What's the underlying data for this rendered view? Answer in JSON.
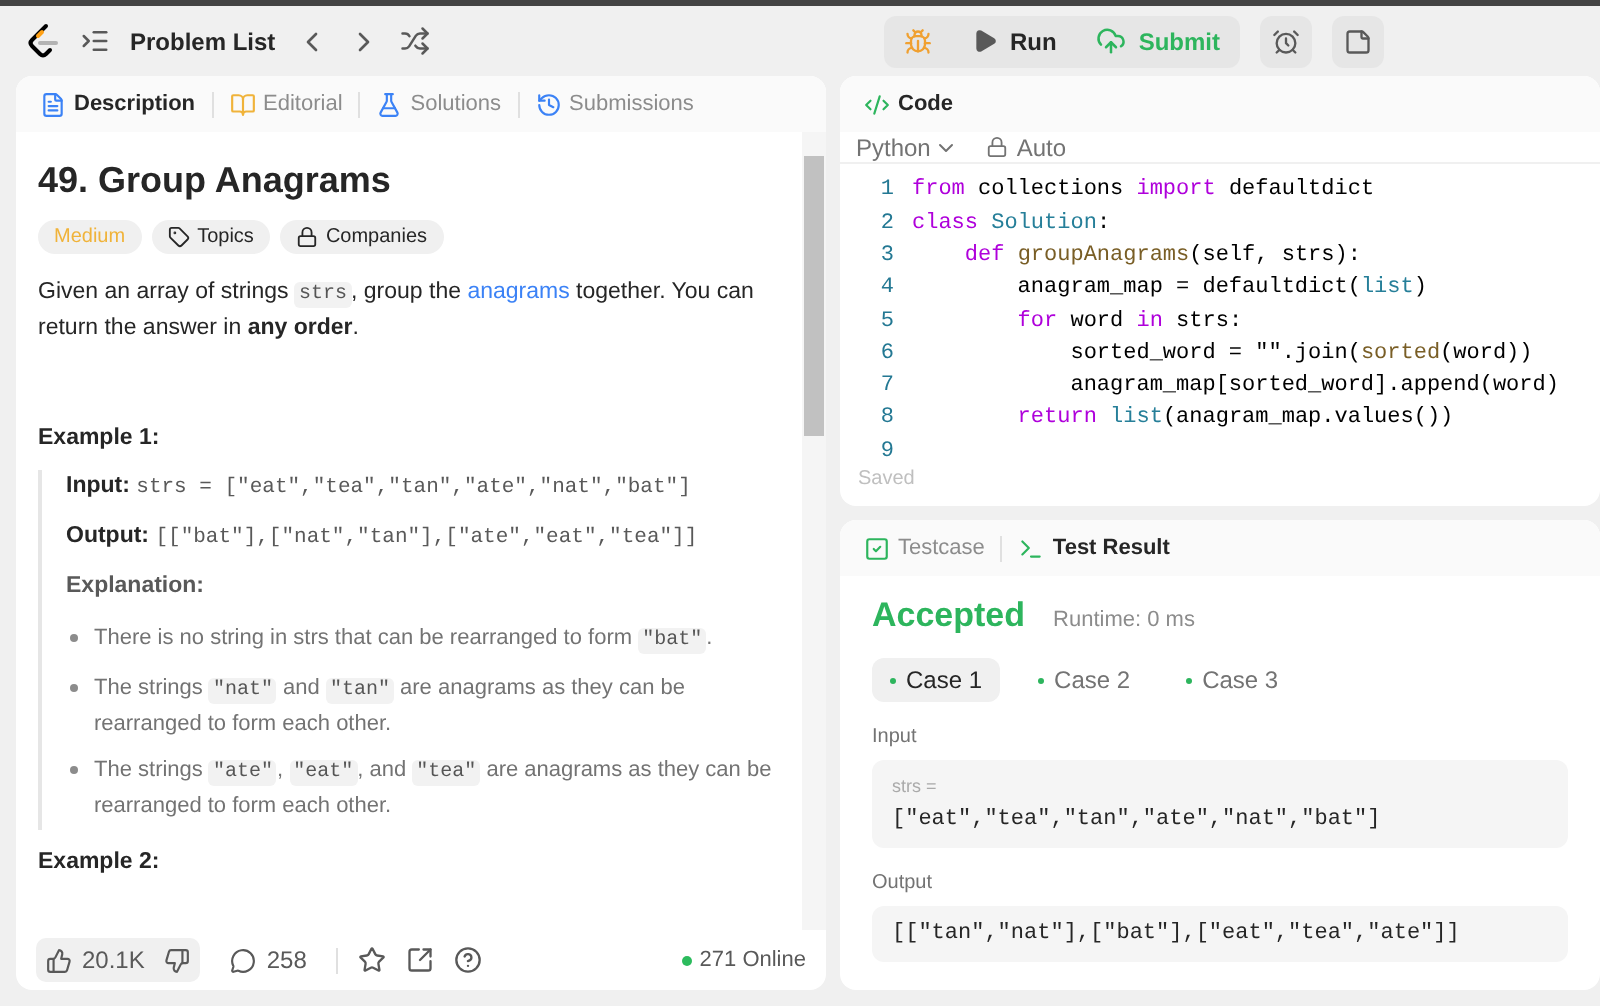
{
  "topbar": {
    "title": "Problem List",
    "run": "Run",
    "submit": "Submit"
  },
  "left_tabs": [
    {
      "label": "Description",
      "selected": true
    },
    {
      "label": "Editorial",
      "selected": false
    },
    {
      "label": "Solutions",
      "selected": false
    },
    {
      "label": "Submissions",
      "selected": false
    }
  ],
  "problem": {
    "title": "49. Group Anagrams",
    "difficulty": "Medium",
    "tags": [
      "Topics",
      "Companies"
    ],
    "statement": [
      {
        "kind": "text",
        "text": "Given an array of strings "
      },
      {
        "kind": "code",
        "text": "strs"
      },
      {
        "kind": "text",
        "text": ", group the "
      },
      {
        "kind": "link",
        "text": "anagrams"
      },
      {
        "kind": "text",
        "text": " together. You can return the answer in "
      },
      {
        "kind": "bold",
        "text": "any order"
      },
      {
        "kind": "text",
        "text": "."
      }
    ],
    "example": {
      "heading": "Example 1:",
      "input_label": "Input:",
      "input": "strs = [\"eat\",\"tea\",\"tan\",\"ate\",\"nat\",\"bat\"]",
      "output_label": "Output:",
      "output": "[[\"bat\"],[\"nat\",\"tan\"],[\"ate\",\"eat\",\"tea\"]]",
      "explanation_label": "Explanation:",
      "bullets": [
        [
          {
            "kind": "text",
            "text": "There is no string in strs that can be rearranged to form "
          },
          {
            "kind": "code",
            "text": "\"bat\""
          },
          {
            "kind": "text",
            "text": "."
          }
        ],
        [
          {
            "kind": "text",
            "text": "The strings "
          },
          {
            "kind": "code",
            "text": "\"nat\""
          },
          {
            "kind": "text",
            "text": " and "
          },
          {
            "kind": "code",
            "text": "\"tan\""
          },
          {
            "kind": "text",
            "text": " are anagrams as they can be rearranged to form each other."
          }
        ],
        [
          {
            "kind": "text",
            "text": "The strings "
          },
          {
            "kind": "code",
            "text": "\"ate\""
          },
          {
            "kind": "text",
            "text": ", "
          },
          {
            "kind": "code",
            "text": "\"eat\""
          },
          {
            "kind": "text",
            "text": ", and "
          },
          {
            "kind": "code",
            "text": "\"tea\""
          },
          {
            "kind": "text",
            "text": " are anagrams as they can be rearranged to form each other."
          }
        ]
      ]
    },
    "next_heading": "Example 2:"
  },
  "footer": {
    "likes": "20.1K",
    "comments": "258",
    "online": "271 Online"
  },
  "code_panel": {
    "title": "Code",
    "language": "Python",
    "mode": "Auto",
    "status": "Saved",
    "lines": [
      {
        "number": "1",
        "tokens": [
          {
            "kind": "keyword",
            "text": "from"
          },
          {
            "kind": "plain",
            "text": " collections "
          },
          {
            "kind": "keyword",
            "text": "import"
          },
          {
            "kind": "plain",
            "text": " defaultdict"
          }
        ]
      },
      {
        "number": "2",
        "tokens": [
          {
            "kind": "keyword",
            "text": "class"
          },
          {
            "kind": "type",
            "text": " Solution"
          },
          {
            "kind": "plain",
            "text": ":"
          }
        ]
      },
      {
        "number": "3",
        "tokens": [
          {
            "kind": "keyword",
            "text": "    def"
          },
          {
            "kind": "func",
            "text": " groupAnagrams"
          },
          {
            "kind": "plain",
            "text": "(self, strs):"
          }
        ]
      },
      {
        "number": "4",
        "tokens": [
          {
            "kind": "plain",
            "text": "        anagram_map = defaultdict("
          },
          {
            "kind": "type",
            "text": "list"
          },
          {
            "kind": "plain",
            "text": ")"
          }
        ]
      },
      {
        "number": "5",
        "tokens": [
          {
            "kind": "keyword",
            "text": "        for"
          },
          {
            "kind": "plain",
            "text": " word "
          },
          {
            "kind": "keyword",
            "text": "in"
          },
          {
            "kind": "plain",
            "text": " strs:"
          }
        ]
      },
      {
        "number": "6",
        "tokens": [
          {
            "kind": "plain",
            "text": "            sorted_word = \"\".join("
          },
          {
            "kind": "func",
            "text": "sorted"
          },
          {
            "kind": "plain",
            "text": "(word))"
          }
        ]
      },
      {
        "number": "7",
        "tokens": [
          {
            "kind": "plain",
            "text": "            anagram_map[sorted_word].append(word)"
          }
        ]
      },
      {
        "number": "8",
        "tokens": [
          {
            "kind": "keyword",
            "text": "        return"
          },
          {
            "kind": "type",
            "text": " list"
          },
          {
            "kind": "plain",
            "text": "(anagram_map.values())"
          }
        ]
      },
      {
        "number": "9"
      }
    ]
  },
  "result_tabs": [
    {
      "label": "Testcase",
      "selected": false
    },
    {
      "label": "Test Result",
      "selected": true
    }
  ],
  "result": {
    "verdict": "Accepted",
    "runtime": "Runtime: 0 ms",
    "cases": [
      {
        "label": "Case 1",
        "selected": true
      },
      {
        "label": "Case 2",
        "selected": false
      },
      {
        "label": "Case 3",
        "selected": false
      }
    ],
    "input_label": "Input",
    "param": "strs =",
    "input": "[\"eat\",\"tea\",\"tan\",\"ate\",\"nat\",\"bat\"]",
    "output_label": "Output",
    "output": "[[\"tan\",\"nat\"],[\"bat\"],[\"eat\",\"tea\",\"ate\"]]"
  }
}
